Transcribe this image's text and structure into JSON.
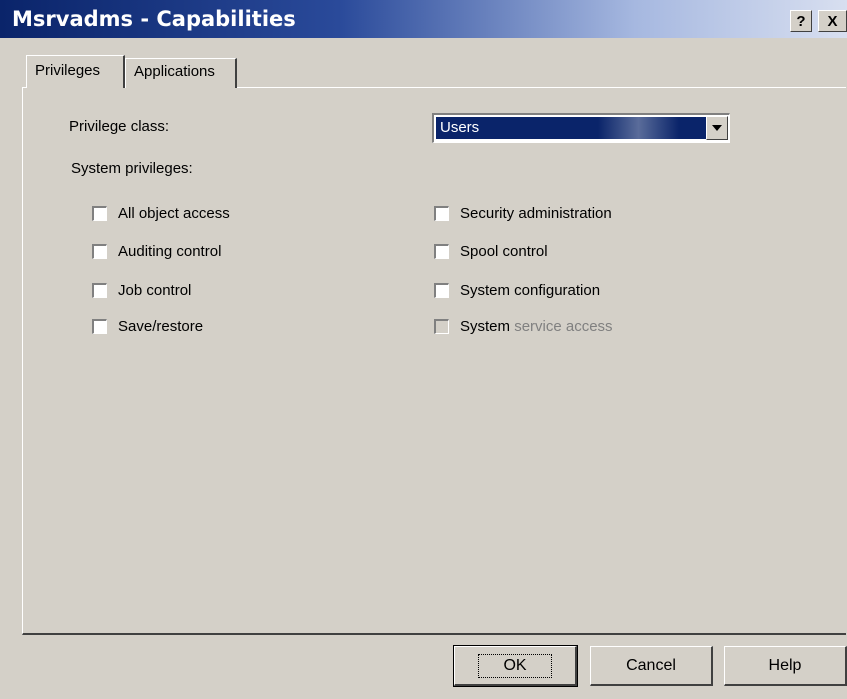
{
  "window": {
    "title": "Msrvadms - Capabilities",
    "help_button": "?",
    "close_button": "X"
  },
  "tabs": [
    {
      "label": "Privileges",
      "active": true
    },
    {
      "label": "Applications",
      "active": false
    }
  ],
  "privileges": {
    "privilege_class_label": "Privilege class:",
    "privilege_class_value": "Users",
    "system_privileges_label": "System privileges:",
    "left_checkboxes": [
      {
        "label": "All object access",
        "checked": false
      },
      {
        "label": "Auditing control",
        "checked": false
      },
      {
        "label": "Job control",
        "checked": false
      },
      {
        "label": "Save/restore",
        "checked": false
      }
    ],
    "right_checkboxes": [
      {
        "label": "Security administration",
        "checked": false
      },
      {
        "label": "Spool control",
        "checked": false
      },
      {
        "label": "System configuration",
        "checked": false
      },
      {
        "label_part1": "System",
        "label_part2": "service access",
        "checked": false,
        "disabled": true
      }
    ]
  },
  "buttons": {
    "ok": "OK",
    "cancel": "Cancel",
    "help": "Help"
  },
  "colors": {
    "title_bar": "#0a246a",
    "dialog_face": "#d4d0c8",
    "selection": "#0a246a"
  }
}
